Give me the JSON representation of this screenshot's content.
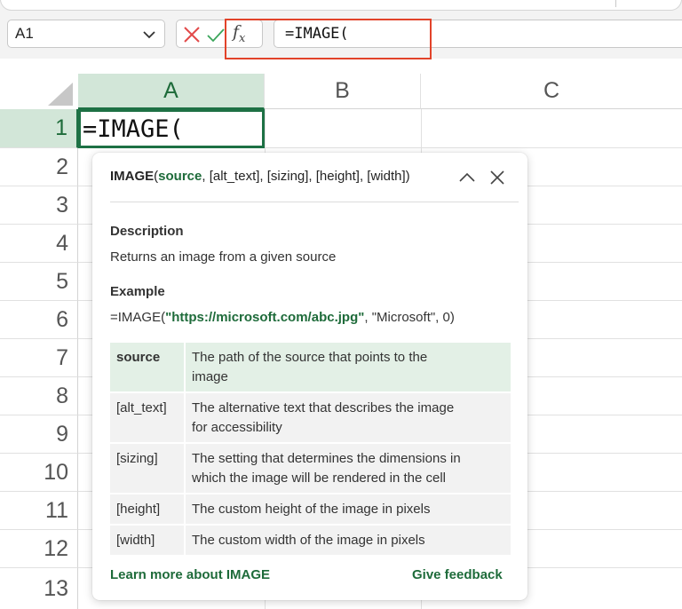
{
  "name_box": {
    "value": "A1"
  },
  "formula_bar": {
    "fx_label": "fx",
    "value": "=IMAGE("
  },
  "columns": [
    "A",
    "B",
    "C"
  ],
  "rows": [
    "1",
    "2",
    "3",
    "4",
    "5",
    "6",
    "7",
    "8",
    "9",
    "10",
    "11",
    "12",
    "13"
  ],
  "active_cell": {
    "ref": "A1",
    "value": "=IMAGE("
  },
  "tooltip": {
    "function_name": "IMAGE",
    "signature_open": "(",
    "current_arg": "source",
    "signature_rest": ", [alt_text], [sizing], [height], [width])",
    "description_heading": "Description",
    "description": "Returns an image from a given source",
    "example_heading": "Example",
    "example_prefix": "=IMAGE(",
    "example_url": "\"https://microsoft.com/abc.jpg\"",
    "example_suffix": ", \"Microsoft\", 0)",
    "params": [
      {
        "name": "source",
        "desc_line1": "The path of the source that points to the",
        "desc_line2": "image"
      },
      {
        "name": "[alt_text]",
        "desc_line1": "The alternative text that describes the image",
        "desc_line2": "for accessibility"
      },
      {
        "name": "[sizing]",
        "desc_line1": "The setting that determines the dimensions in",
        "desc_line2": "which the image will be rendered in the cell"
      },
      {
        "name": "[height]",
        "desc_line1": "The custom height of the image in pixels",
        "desc_line2": ""
      },
      {
        "name": "[width]",
        "desc_line1": "The custom width of the image in pixels",
        "desc_line2": ""
      }
    ],
    "learn_more": "Learn more about IMAGE",
    "feedback": "Give feedback"
  },
  "colors": {
    "accent_green": "#1e7145",
    "highlight_red": "#e2432a",
    "cancel_red": "#e24a4a",
    "confirm_green": "#3aa55a"
  },
  "icons": [
    "chevron-down-icon",
    "cancel-icon",
    "check-icon",
    "fx-icon",
    "collapse-up-icon",
    "close-icon",
    "select-all-triangle-icon"
  ]
}
